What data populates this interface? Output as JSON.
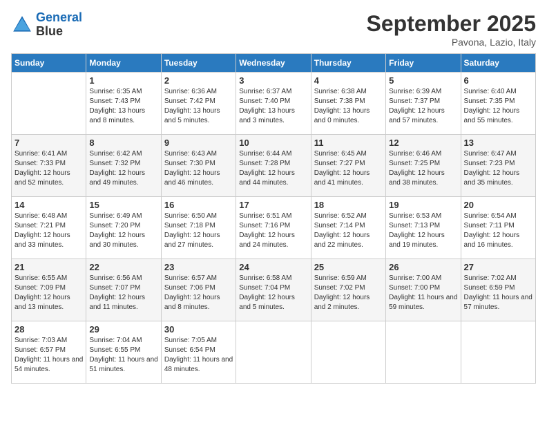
{
  "header": {
    "logo_line1": "General",
    "logo_line2": "Blue",
    "month": "September 2025",
    "location": "Pavona, Lazio, Italy"
  },
  "weekdays": [
    "Sunday",
    "Monday",
    "Tuesday",
    "Wednesday",
    "Thursday",
    "Friday",
    "Saturday"
  ],
  "weeks": [
    [
      {
        "day": "",
        "sunrise": "",
        "sunset": "",
        "daylight": ""
      },
      {
        "day": "1",
        "sunrise": "Sunrise: 6:35 AM",
        "sunset": "Sunset: 7:43 PM",
        "daylight": "Daylight: 13 hours and 8 minutes."
      },
      {
        "day": "2",
        "sunrise": "Sunrise: 6:36 AM",
        "sunset": "Sunset: 7:42 PM",
        "daylight": "Daylight: 13 hours and 5 minutes."
      },
      {
        "day": "3",
        "sunrise": "Sunrise: 6:37 AM",
        "sunset": "Sunset: 7:40 PM",
        "daylight": "Daylight: 13 hours and 3 minutes."
      },
      {
        "day": "4",
        "sunrise": "Sunrise: 6:38 AM",
        "sunset": "Sunset: 7:38 PM",
        "daylight": "Daylight: 13 hours and 0 minutes."
      },
      {
        "day": "5",
        "sunrise": "Sunrise: 6:39 AM",
        "sunset": "Sunset: 7:37 PM",
        "daylight": "Daylight: 12 hours and 57 minutes."
      },
      {
        "day": "6",
        "sunrise": "Sunrise: 6:40 AM",
        "sunset": "Sunset: 7:35 PM",
        "daylight": "Daylight: 12 hours and 55 minutes."
      }
    ],
    [
      {
        "day": "7",
        "sunrise": "Sunrise: 6:41 AM",
        "sunset": "Sunset: 7:33 PM",
        "daylight": "Daylight: 12 hours and 52 minutes."
      },
      {
        "day": "8",
        "sunrise": "Sunrise: 6:42 AM",
        "sunset": "Sunset: 7:32 PM",
        "daylight": "Daylight: 12 hours and 49 minutes."
      },
      {
        "day": "9",
        "sunrise": "Sunrise: 6:43 AM",
        "sunset": "Sunset: 7:30 PM",
        "daylight": "Daylight: 12 hours and 46 minutes."
      },
      {
        "day": "10",
        "sunrise": "Sunrise: 6:44 AM",
        "sunset": "Sunset: 7:28 PM",
        "daylight": "Daylight: 12 hours and 44 minutes."
      },
      {
        "day": "11",
        "sunrise": "Sunrise: 6:45 AM",
        "sunset": "Sunset: 7:27 PM",
        "daylight": "Daylight: 12 hours and 41 minutes."
      },
      {
        "day": "12",
        "sunrise": "Sunrise: 6:46 AM",
        "sunset": "Sunset: 7:25 PM",
        "daylight": "Daylight: 12 hours and 38 minutes."
      },
      {
        "day": "13",
        "sunrise": "Sunrise: 6:47 AM",
        "sunset": "Sunset: 7:23 PM",
        "daylight": "Daylight: 12 hours and 35 minutes."
      }
    ],
    [
      {
        "day": "14",
        "sunrise": "Sunrise: 6:48 AM",
        "sunset": "Sunset: 7:21 PM",
        "daylight": "Daylight: 12 hours and 33 minutes."
      },
      {
        "day": "15",
        "sunrise": "Sunrise: 6:49 AM",
        "sunset": "Sunset: 7:20 PM",
        "daylight": "Daylight: 12 hours and 30 minutes."
      },
      {
        "day": "16",
        "sunrise": "Sunrise: 6:50 AM",
        "sunset": "Sunset: 7:18 PM",
        "daylight": "Daylight: 12 hours and 27 minutes."
      },
      {
        "day": "17",
        "sunrise": "Sunrise: 6:51 AM",
        "sunset": "Sunset: 7:16 PM",
        "daylight": "Daylight: 12 hours and 24 minutes."
      },
      {
        "day": "18",
        "sunrise": "Sunrise: 6:52 AM",
        "sunset": "Sunset: 7:14 PM",
        "daylight": "Daylight: 12 hours and 22 minutes."
      },
      {
        "day": "19",
        "sunrise": "Sunrise: 6:53 AM",
        "sunset": "Sunset: 7:13 PM",
        "daylight": "Daylight: 12 hours and 19 minutes."
      },
      {
        "day": "20",
        "sunrise": "Sunrise: 6:54 AM",
        "sunset": "Sunset: 7:11 PM",
        "daylight": "Daylight: 12 hours and 16 minutes."
      }
    ],
    [
      {
        "day": "21",
        "sunrise": "Sunrise: 6:55 AM",
        "sunset": "Sunset: 7:09 PM",
        "daylight": "Daylight: 12 hours and 13 minutes."
      },
      {
        "day": "22",
        "sunrise": "Sunrise: 6:56 AM",
        "sunset": "Sunset: 7:07 PM",
        "daylight": "Daylight: 12 hours and 11 minutes."
      },
      {
        "day": "23",
        "sunrise": "Sunrise: 6:57 AM",
        "sunset": "Sunset: 7:06 PM",
        "daylight": "Daylight: 12 hours and 8 minutes."
      },
      {
        "day": "24",
        "sunrise": "Sunrise: 6:58 AM",
        "sunset": "Sunset: 7:04 PM",
        "daylight": "Daylight: 12 hours and 5 minutes."
      },
      {
        "day": "25",
        "sunrise": "Sunrise: 6:59 AM",
        "sunset": "Sunset: 7:02 PM",
        "daylight": "Daylight: 12 hours and 2 minutes."
      },
      {
        "day": "26",
        "sunrise": "Sunrise: 7:00 AM",
        "sunset": "Sunset: 7:00 PM",
        "daylight": "Daylight: 11 hours and 59 minutes."
      },
      {
        "day": "27",
        "sunrise": "Sunrise: 7:02 AM",
        "sunset": "Sunset: 6:59 PM",
        "daylight": "Daylight: 11 hours and 57 minutes."
      }
    ],
    [
      {
        "day": "28",
        "sunrise": "Sunrise: 7:03 AM",
        "sunset": "Sunset: 6:57 PM",
        "daylight": "Daylight: 11 hours and 54 minutes."
      },
      {
        "day": "29",
        "sunrise": "Sunrise: 7:04 AM",
        "sunset": "Sunset: 6:55 PM",
        "daylight": "Daylight: 11 hours and 51 minutes."
      },
      {
        "day": "30",
        "sunrise": "Sunrise: 7:05 AM",
        "sunset": "Sunset: 6:54 PM",
        "daylight": "Daylight: 11 hours and 48 minutes."
      },
      {
        "day": "",
        "sunrise": "",
        "sunset": "",
        "daylight": ""
      },
      {
        "day": "",
        "sunrise": "",
        "sunset": "",
        "daylight": ""
      },
      {
        "day": "",
        "sunrise": "",
        "sunset": "",
        "daylight": ""
      },
      {
        "day": "",
        "sunrise": "",
        "sunset": "",
        "daylight": ""
      }
    ]
  ]
}
